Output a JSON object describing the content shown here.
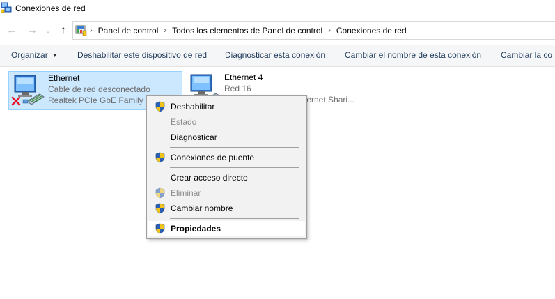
{
  "window": {
    "title": "Conexiones de red",
    "icon": "network-connections-icon"
  },
  "navigation": {
    "back_icon": "arrow-left-icon",
    "forward_icon": "arrow-right-icon",
    "recent_icon": "chevron-down-icon",
    "up_icon": "arrow-up-icon",
    "breadcrumbs": [
      "Panel de control",
      "Todos los elementos de Panel de control",
      "Conexiones de red"
    ]
  },
  "commandbar": {
    "organize": "Organizar",
    "disable_device": "Deshabilitar este dispositivo de red",
    "diagnose": "Diagnosticar esta conexión",
    "rename": "Cambiar el nombre de esta conexión",
    "change": "Cambiar la co"
  },
  "connections": [
    {
      "name": "Ethernet",
      "status": "Cable de red desconectado",
      "device": "Realtek PCIe GbE Family Co",
      "selected": true,
      "error_icon": "red-x-icon"
    },
    {
      "name": "Ethernet 4",
      "status": "Red 16",
      "device": "ternet Shari...",
      "selected": false
    }
  ],
  "context_menu": {
    "items": [
      {
        "label": "Deshabilitar",
        "shield": true,
        "disabled": false,
        "bold": false
      },
      {
        "label": "Estado",
        "shield": false,
        "disabled": true,
        "bold": false
      },
      {
        "label": "Diagnosticar",
        "shield": false,
        "disabled": false,
        "bold": false
      },
      {
        "label": "Conexiones de puente",
        "shield": true,
        "disabled": false,
        "bold": false
      },
      {
        "label": "Crear acceso directo",
        "shield": false,
        "disabled": false,
        "bold": false
      },
      {
        "label": "Eliminar",
        "shield": true,
        "disabled": true,
        "bold": false
      },
      {
        "label": "Cambiar nombre",
        "shield": true,
        "disabled": false,
        "bold": false
      },
      {
        "label": "Propiedades",
        "shield": true,
        "disabled": false,
        "bold": true
      }
    ]
  },
  "colors": {
    "selection_bg": "#cce8ff",
    "selection_border": "#99d1ff",
    "command_text": "#1e395b",
    "menu_bg": "#f2f2f2"
  }
}
